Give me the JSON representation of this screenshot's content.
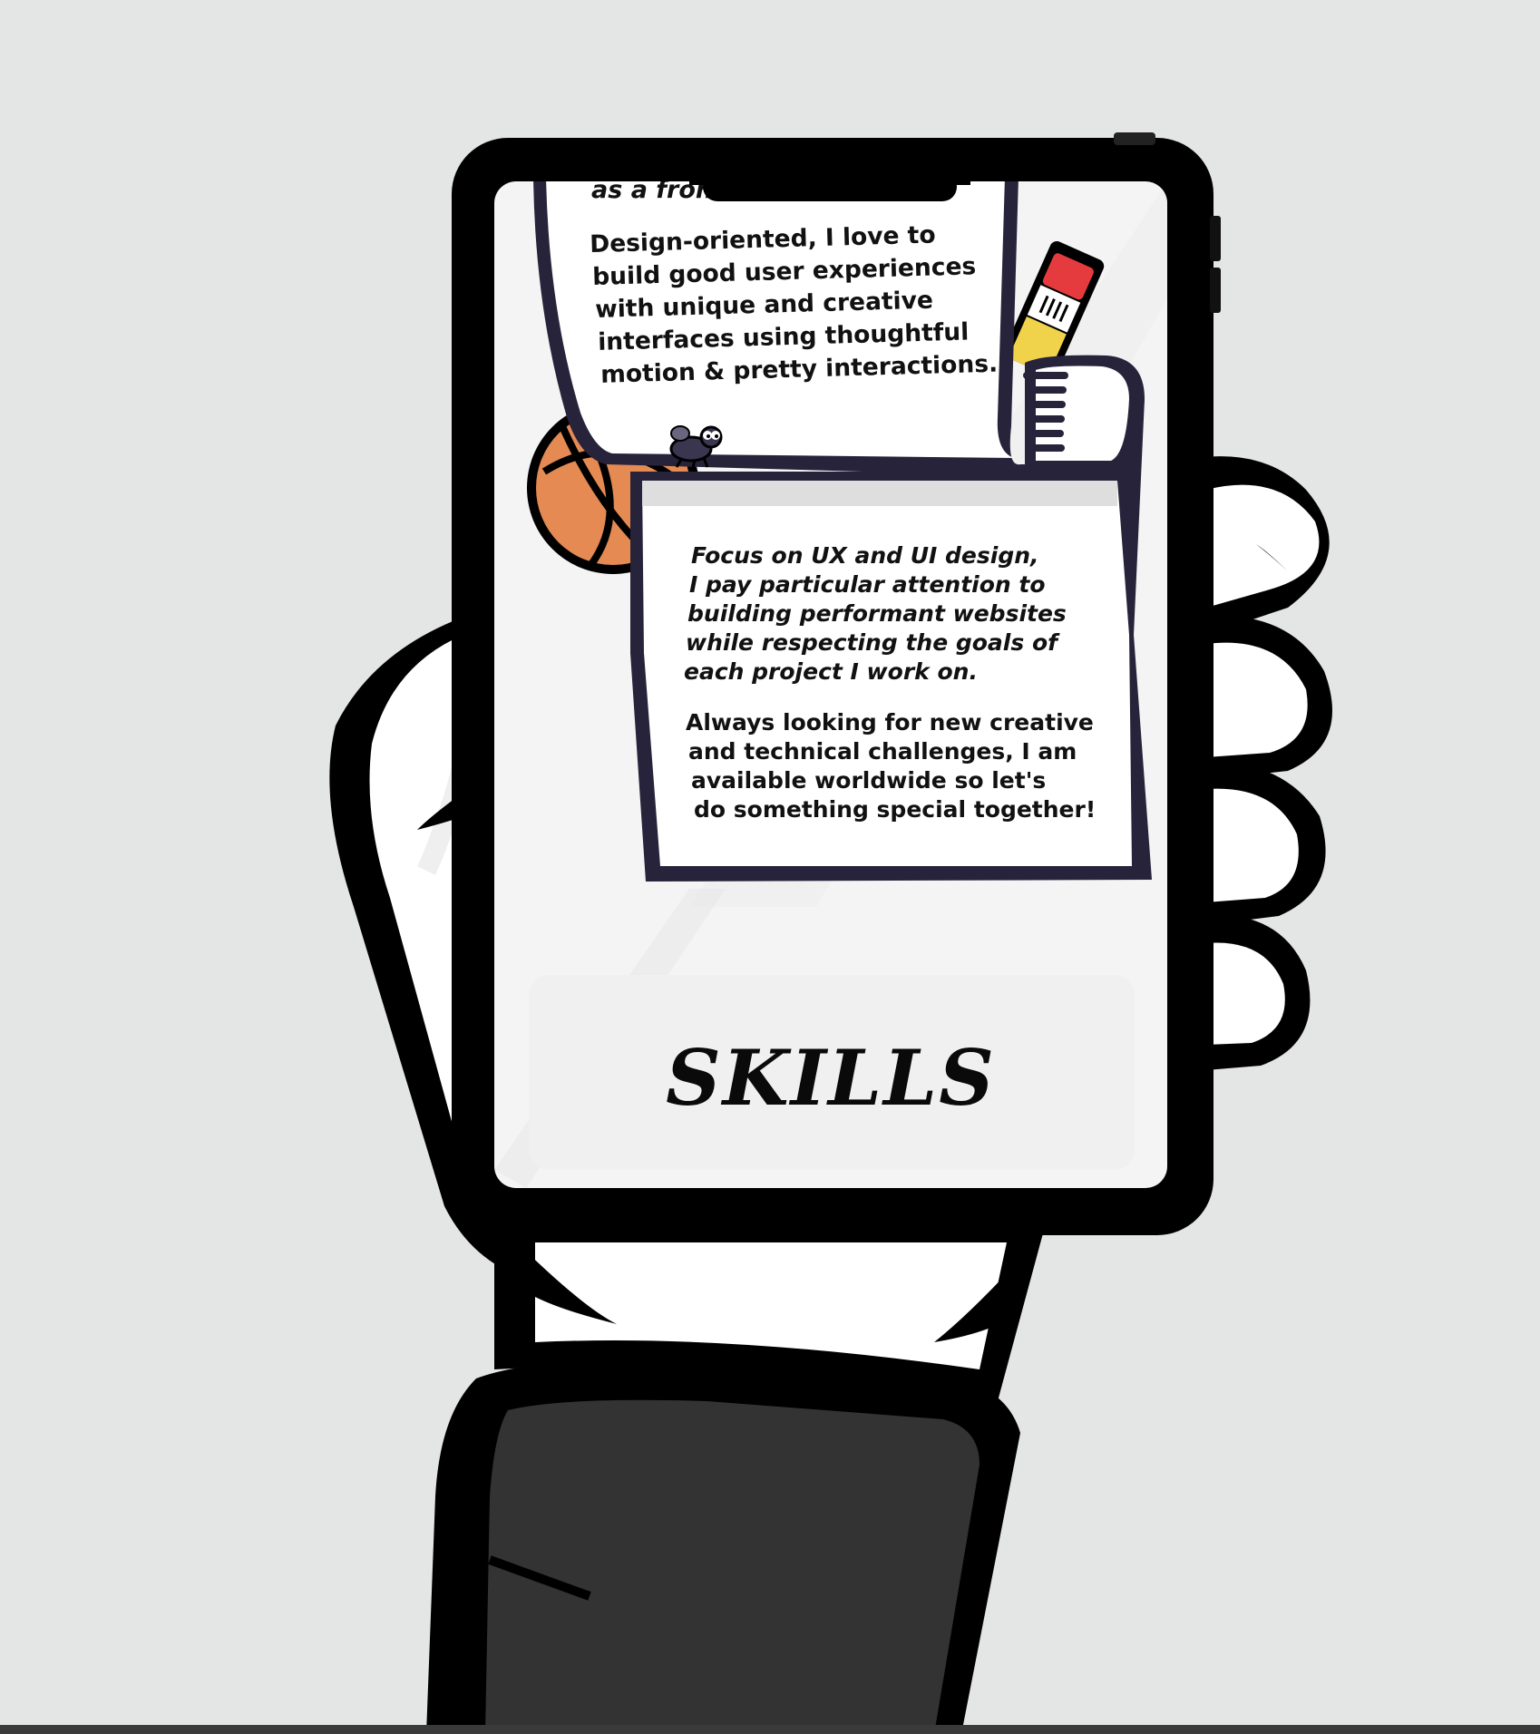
{
  "scroll_top": {
    "partial_line": "as a fron"
  },
  "paper_top": {
    "lines": [
      "Design-oriented, I love to",
      "build good user experiences",
      "with unique and creative",
      "interfaces using thoughtful",
      "motion & pretty interactions."
    ]
  },
  "paper_bottom": {
    "paragraph_1": [
      "Focus on UX and UI design,",
      "I pay particular attention to",
      "building performant websites",
      "while respecting the goals of",
      "each project I work on."
    ],
    "paragraph_2": [
      "Always looking for new creative",
      "and technical challenges, I am",
      "available worldwide so let's",
      "do something special together!"
    ]
  },
  "skills": {
    "title": "SKILLS"
  },
  "colors": {
    "background": "#e4e6e5",
    "phone_frame": "#000000",
    "screen": "#f4f4f4",
    "paper_outline": "#27233a",
    "basketball": "#e48a52",
    "pencil_eraser": "#e63b3e",
    "pencil_body": "#f0d34a",
    "sleeve": "#333333"
  }
}
